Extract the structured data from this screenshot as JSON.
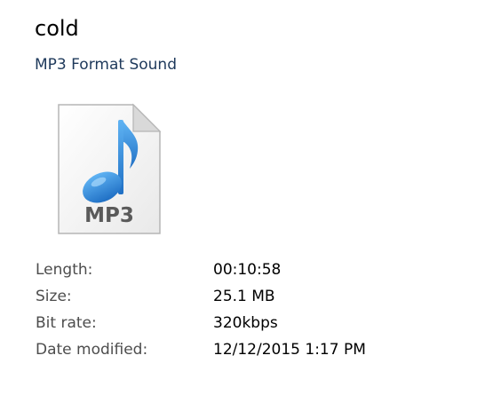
{
  "file": {
    "name": "cold",
    "type": "MP3 Format Sound",
    "icon": "mp3-file-icon",
    "icon_badge": "MP3"
  },
  "properties": [
    {
      "label": "Length:",
      "value": "00:10:58"
    },
    {
      "label": "Size:",
      "value": "25.1 MB"
    },
    {
      "label": "Bit rate:",
      "value": "320kbps"
    },
    {
      "label": "Date modified:",
      "value": "12/12/2015 1:17 PM"
    }
  ],
  "colors": {
    "subtitle": "#1e395b",
    "label": "#4d4d4d",
    "note": "#2b86d8"
  }
}
